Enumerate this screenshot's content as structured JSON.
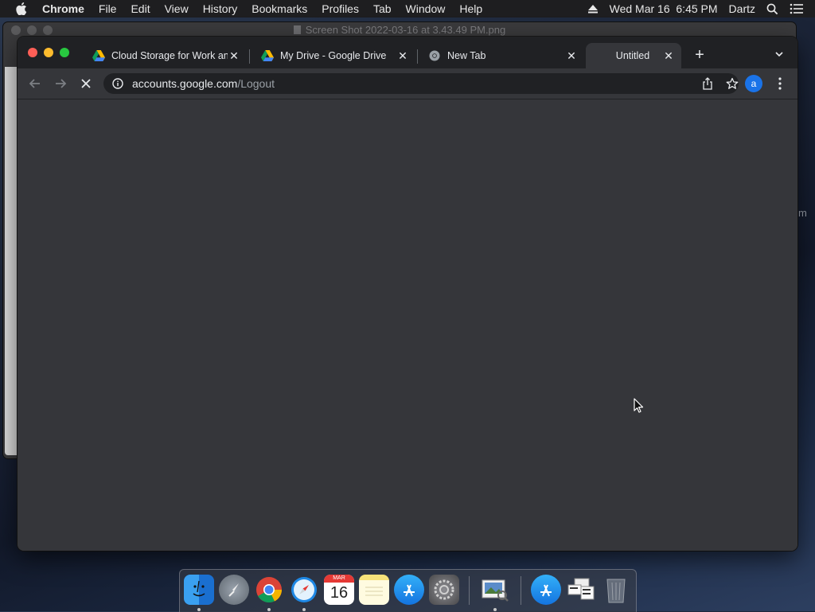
{
  "menubar": {
    "app_name": "Chrome",
    "items": [
      "File",
      "Edit",
      "View",
      "History",
      "Bookmarks",
      "Profiles",
      "Tab",
      "Window",
      "Help"
    ],
    "datetime": "Wed Mar 16  6:45 PM",
    "user": "Dartz"
  },
  "background_window": {
    "title": "Screen Shot 2022-03-16 at 3.43.49 PM.png",
    "edge_char": "m"
  },
  "chrome": {
    "tabs": [
      {
        "title": "Cloud Storage for Work and",
        "favicon": "google-drive-icon"
      },
      {
        "title": "My Drive - Google Drive",
        "favicon": "google-drive-icon"
      },
      {
        "title": "New Tab",
        "favicon": "chrome-icon"
      },
      {
        "title": "Untitled",
        "favicon": "none",
        "active": true
      }
    ],
    "url_host": "accounts.google.com",
    "url_path": "/Logout",
    "avatar_letter": "a",
    "colors": {
      "frame": "#202124",
      "toolbar": "#35363a",
      "avatar": "#1a73e8"
    }
  },
  "dock": {
    "calendar_month": "MAR",
    "calendar_day": "16",
    "items": [
      "finder",
      "launchpad",
      "chrome",
      "safari",
      "calendar",
      "notes",
      "app-store",
      "system-preferences",
      "preview",
      "app-store-downloads",
      "documents",
      "trash"
    ]
  }
}
